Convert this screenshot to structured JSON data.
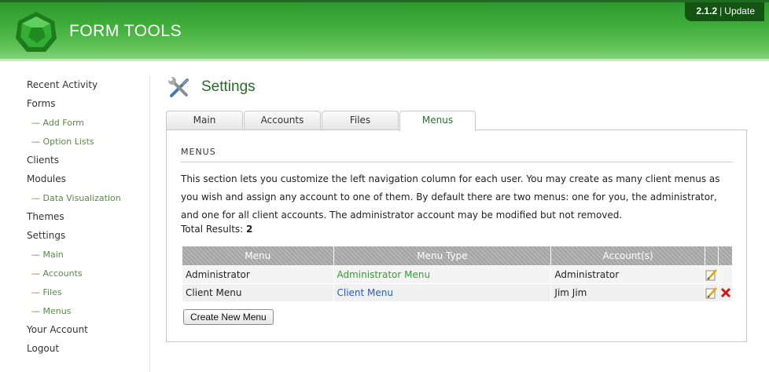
{
  "header": {
    "app_title": "FORM TOOLS",
    "version": "2.1.2",
    "update_label": "Update"
  },
  "sidebar": {
    "items": [
      {
        "label": "Recent Activity"
      },
      {
        "label": "Forms"
      },
      {
        "label": "— Add Form"
      },
      {
        "label": "— Option Lists"
      },
      {
        "label": "Clients"
      },
      {
        "label": "Modules"
      },
      {
        "label": "— Data Visualization"
      },
      {
        "label": "Themes"
      },
      {
        "label": "Settings"
      },
      {
        "label": "— Main"
      },
      {
        "label": "— Accounts"
      },
      {
        "label": "— Files"
      },
      {
        "label": "— Menus"
      },
      {
        "label": "Your Account"
      },
      {
        "label": "Logout"
      }
    ]
  },
  "main": {
    "page_title": "Settings",
    "tabs": [
      {
        "label": "Main"
      },
      {
        "label": "Accounts"
      },
      {
        "label": "Files"
      },
      {
        "label": "Menus",
        "active": true
      }
    ],
    "section_title": "MENUS",
    "intro": "This section lets you customize the left navigation column for each user. You may create as many client menus as you wish and assign any account to one of them. By default there are two menus: one for you, the administrator, and one for all client accounts. The administrator account may be modified but not removed.",
    "total_label": "Total Results:",
    "total_value": "2",
    "table": {
      "headers": [
        "Menu",
        "Menu Type",
        "Account(s)"
      ],
      "rows": [
        {
          "menu": "Administrator",
          "menu_type": "Administrator Menu",
          "accounts": "Administrator"
        },
        {
          "menu": "Client Menu",
          "menu_type": "Client Menu",
          "accounts": "Jim Jim"
        }
      ]
    },
    "create_button_label": "Create New Menu"
  },
  "colors": {
    "header_green": "#3fae3a",
    "title_green": "#2a6a2a",
    "admin_link": "#2aa42a",
    "client_link": "#2e5aa8",
    "delete_red": "#d01818"
  },
  "icons": [
    "logo-icon",
    "settings-tools-icon",
    "edit-icon",
    "delete-icon"
  ]
}
